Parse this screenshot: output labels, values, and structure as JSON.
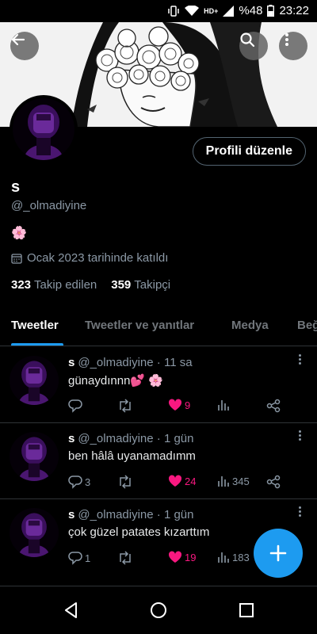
{
  "status": {
    "battery": "%48",
    "time": "23:22",
    "network": "HD+"
  },
  "profile": {
    "name": "s",
    "handle": "@_olmadiyine",
    "bio": "🌸",
    "joined": "Ocak 2023 tarihinde katıldı",
    "following_count": "323",
    "following_label": "Takip edilen",
    "followers_count": "359",
    "followers_label": "Takipçi",
    "edit_label": "Profili düzenle"
  },
  "tabs": [
    {
      "label": "Tweetler",
      "active": true
    },
    {
      "label": "Tweetler ve yanıtlar",
      "active": false
    },
    {
      "label": "Medya",
      "active": false
    },
    {
      "label": "Beğ",
      "active": false
    }
  ],
  "tweets": [
    {
      "name": "s",
      "handle": "@_olmadiyine",
      "time": "· 11 sa",
      "text": "günaydınnn💕 🌸",
      "replies": "",
      "retweets": "",
      "likes": "9",
      "views": ""
    },
    {
      "name": "s",
      "handle": "@_olmadiyine",
      "time": "· 1 gün",
      "text": "ben hâlâ uyanamadımm",
      "replies": "3",
      "retweets": "",
      "likes": "24",
      "views": "345"
    },
    {
      "name": "s",
      "handle": "@_olmadiyine",
      "time": "· 1 gün",
      "text": "çok güzel patates kızarttım",
      "replies": "1",
      "retweets": "",
      "likes": "19",
      "views": "183"
    }
  ],
  "colors": {
    "accent": "#1d9bf0",
    "like": "#f91880",
    "muted": "#8b98a5",
    "avatar": "#5a1a8a"
  },
  "icons": [
    "back-arrow-icon",
    "search-icon",
    "more-vertical-icon",
    "calendar-icon",
    "reply-icon",
    "retweet-icon",
    "heart-icon",
    "views-icon",
    "share-icon",
    "plus-icon",
    "nav-back-icon",
    "nav-home-icon",
    "nav-recents-icon"
  ]
}
